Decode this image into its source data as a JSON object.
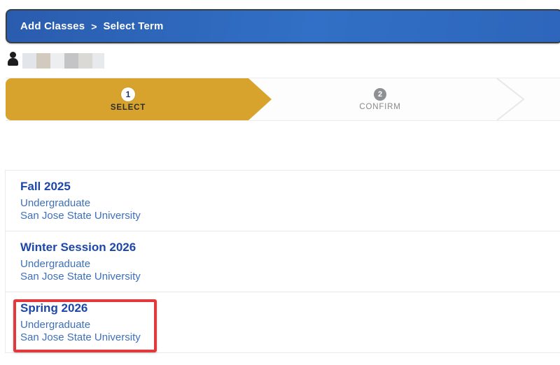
{
  "header": {
    "breadcrumb": [
      "Add Classes",
      "Select Term"
    ],
    "separator": ">"
  },
  "user": {
    "icon": "person-icon",
    "name_redacted": true
  },
  "steps": [
    {
      "number": "1",
      "label": "SELECT",
      "state": "active"
    },
    {
      "number": "2",
      "label": "CONFIRM",
      "state": "upcoming"
    }
  ],
  "terms": [
    {
      "name": "Fall 2025",
      "career": "Undergraduate",
      "institution": "San Jose State University",
      "highlighted": false
    },
    {
      "name": "Winter Session 2026",
      "career": "Undergraduate",
      "institution": "San Jose State University",
      "highlighted": false
    },
    {
      "name": "Spring 2026",
      "career": "Undergraduate",
      "institution": "San Jose State University",
      "highlighted": true
    }
  ],
  "colors": {
    "header_blue": "#2c63b8",
    "header_border": "#373e46",
    "step_active_gold": "#d7a32c",
    "step_inactive_gray": "#8e9092",
    "term_title_blue": "#1c47a9",
    "term_subtitle_blue": "#3e6fbb",
    "highlight_red": "#e23a3c",
    "redacted_blocks": [
      "#e2e6ea",
      "#d3cabf",
      "#eceef0",
      "#c4c4c6",
      "#dbd9d6",
      "#e7e9ec"
    ]
  }
}
